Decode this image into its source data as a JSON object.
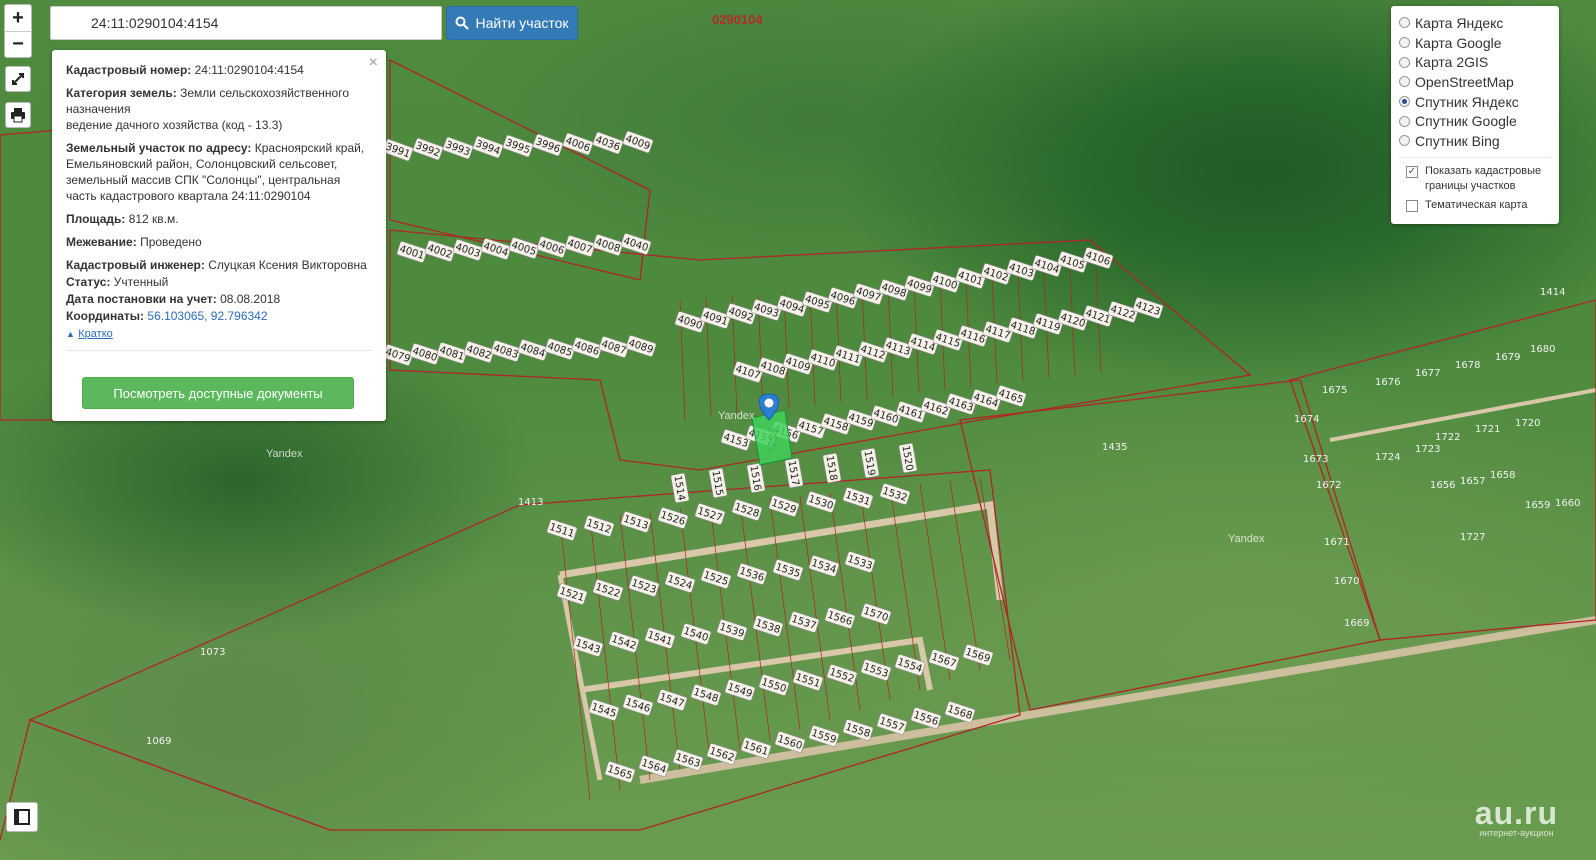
{
  "search": {
    "query": "24:11:0290104:4154",
    "button_label": "Найти участок"
  },
  "map_controls": {
    "zoom_in": "+",
    "zoom_out": "−"
  },
  "info_panel": {
    "cad_label": "Кадастровый номер:",
    "cad_value": "24:11:0290104:4154",
    "category_label": "Категория земель:",
    "category_value": "Земли сельскохозяйственного назначения",
    "usage_value": "ведение дачного хозяйства (код - 13.3)",
    "address_label": "Земельный участок по адресу:",
    "address_value": "Красноярский край, Емельяновский район, Солонцовский сельсовет, земельный массив СПК \"Солонцы\", центральная часть кадастрового квартала 24:11:0290104",
    "area_label": "Площадь:",
    "area_value": "812 кв.м.",
    "survey_label": "Межевание:",
    "survey_value": "Проведено",
    "engineer_label": "Кадастровый инженер:",
    "engineer_value": "Слуцкая Ксения Викторовна",
    "status_label": "Статус:",
    "status_value": "Учтенный",
    "date_label": "Дата постановки на учет:",
    "date_value": "08.08.2018",
    "coords_label": "Координаты:",
    "coords_value": "56.103065, 92.796342",
    "short_link": "Кратко",
    "docs_button": "Посмотреть доступные документы",
    "close": "×"
  },
  "layers": {
    "options": [
      {
        "label": "Карта Яндекс",
        "selected": false
      },
      {
        "label": "Карта Google",
        "selected": false
      },
      {
        "label": "Карта 2GIS",
        "selected": false
      },
      {
        "label": "OpenStreetMap",
        "selected": false
      },
      {
        "label": "Спутник Яндекс",
        "selected": true
      },
      {
        "label": "Спутник Google",
        "selected": false
      },
      {
        "label": "Спутник Bing",
        "selected": false
      }
    ],
    "show_borders_label": "Показать кадастровые границы участков",
    "show_borders_checked": true,
    "thematic_label": "Тематическая карта",
    "thematic_checked": false
  },
  "map": {
    "quarter_label": "0290104",
    "yandex_label": "Yandex",
    "parcels_row1": [
      "3991",
      "3992",
      "3993",
      "3994",
      "3995",
      "3996",
      "4006",
      "4036",
      "4009"
    ],
    "parcels_row2": [
      "4001",
      "4002",
      "4003",
      "4004",
      "4005",
      "4006",
      "4007",
      "4008",
      "4040"
    ],
    "parcels_row3": [
      "4079",
      "4080",
      "4081",
      "4082",
      "4083",
      "4084",
      "4085",
      "4086",
      "4087",
      "4089"
    ],
    "parcels_row4": [
      "4090",
      "4091",
      "4092",
      "4093",
      "4094",
      "4095",
      "4096",
      "4097",
      "4098",
      "4099",
      "4100",
      "4101",
      "4102",
      "4103",
      "4104",
      "4105",
      "4106"
    ],
    "parcels_row5": [
      "4107",
      "4108",
      "4109",
      "4110",
      "4111",
      "4112",
      "4113",
      "4114",
      "4115",
      "4116",
      "4117",
      "4118",
      "4119",
      "4120",
      "4121",
      "4122",
      "4123"
    ],
    "parcels_row6": [
      "4153",
      "4155",
      "4156",
      "4157",
      "4158",
      "4159",
      "4160",
      "4161",
      "4162",
      "4163",
      "4164",
      "4165"
    ],
    "parcels_row7": [
      "1514",
      "1515",
      "1516",
      "1517",
      "1518",
      "1519",
      "1520"
    ],
    "parcels_row8": [
      "1511",
      "1512",
      "1513",
      "1526",
      "1527",
      "1528",
      "1529",
      "1530",
      "1531",
      "1532"
    ],
    "parcels_row9": [
      "1521",
      "1522",
      "1523",
      "1524",
      "1525",
      "1536",
      "1535",
      "1534",
      "1533"
    ],
    "parcels_row10": [
      "1543",
      "1542",
      "1541",
      "1540",
      "1539",
      "1538",
      "1537",
      "1566",
      "1570"
    ],
    "parcels_row11": [
      "1545",
      "1546",
      "1547",
      "1548",
      "1549",
      "1550",
      "1551",
      "1552",
      "1553",
      "1554",
      "1567",
      "1569"
    ],
    "parcels_row12": [
      "1565",
      "1564",
      "1563",
      "1562",
      "1561",
      "1560",
      "1559",
      "1558",
      "1557",
      "1556",
      "1568"
    ],
    "parcels_right": [
      "1675",
      "1676",
      "1677",
      "1678",
      "1679",
      "1680",
      "1674",
      "1722",
      "1721",
      "1720",
      "1673",
      "1724",
      "1723",
      "1672",
      "1656",
      "1657",
      "1658",
      "1659",
      "1660",
      "1671",
      "1727",
      "1670",
      "1669",
      "1435",
      "1413",
      "1073",
      "1069",
      "1414"
    ],
    "selected_parcel": "4154"
  },
  "watermark": {
    "brand": "au.ru",
    "tagline": "интернет-аукцион"
  },
  "colors": {
    "accent_blue": "#337ab7",
    "accent_green": "#5cb85c",
    "parcel_border": "#b02525",
    "selected_parcel": "#3fd15a"
  }
}
